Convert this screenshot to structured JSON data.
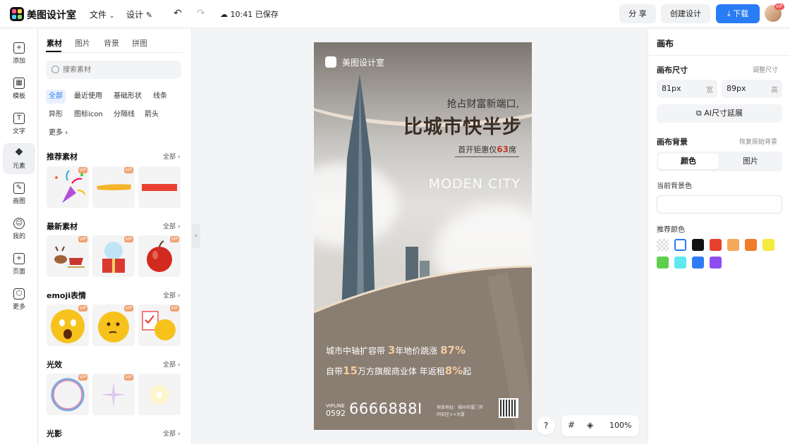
{
  "header": {
    "brand": "美图设计室",
    "menu_file": "文件",
    "menu_design": "设计",
    "saved_status": "10:41 已保存",
    "share_label": "分 享",
    "create_label": "创建设计",
    "download_label": "下载",
    "avatar_badge": "VIP"
  },
  "rail": {
    "items": [
      {
        "label": "添加",
        "icon": "plus-square-icon"
      },
      {
        "label": "模板",
        "icon": "template-grid-icon"
      },
      {
        "label": "文字",
        "icon": "text-T-icon"
      },
      {
        "label": "元素",
        "icon": "shapes-icon"
      },
      {
        "label": "画图",
        "icon": "draw-edit-icon"
      },
      {
        "label": "我的",
        "icon": "user-icon"
      },
      {
        "label": "页面",
        "icon": "add-page-icon"
      },
      {
        "label": "更多",
        "icon": "cube-icon"
      }
    ],
    "active": "元素"
  },
  "panel": {
    "tabs": [
      "素材",
      "图片",
      "背景",
      "拼图"
    ],
    "search_placeholder": "搜索素材",
    "chips": [
      "全部",
      "最近使用",
      "基础形状",
      "线条",
      "异形",
      "图标icon",
      "分隔线",
      "箭头",
      "更多"
    ],
    "all_label": "全部",
    "sections": [
      {
        "title": "推荐素材",
        "items": [
          "confetti-party-popper",
          "yellow-brush-stroke",
          "red-rectangle"
        ]
      },
      {
        "title": "最新素材",
        "items": [
          "reindeer-sleigh",
          "snow-globe-gift",
          "red-apple"
        ]
      },
      {
        "title": "emoji表情",
        "items": [
          "shocked-emoji",
          "thinking-emoji",
          "checklist-chick-emoji"
        ]
      },
      {
        "title": "光效",
        "items": [
          "rainbow-bubble",
          "purple-sparkle",
          "yellow-glow"
        ]
      },
      {
        "title": "光影"
      }
    ],
    "vip_badge": "VIP"
  },
  "poster": {
    "brand": "美图设计室",
    "line1": "抢占财富新端口,",
    "line2": "比城市快半步",
    "line3_pre": "首开钜惠仅",
    "line3_num": "63",
    "line3_post": "席",
    "moden": "MODEN CITY",
    "b1_pre": "城市中轴扩容带",
    "b1_num1": "3",
    "b1_mid": "年地价跳涨",
    "b1_num2": "87%",
    "b2_pre": "自带",
    "b2_num1": "15",
    "b2_mid": "万方旗舰商业体  年返租",
    "b2_num2": "8%",
    "b2_post": "起",
    "vipline": "VIPLINE",
    "area_code": "0592",
    "phone": "6666888I",
    "addr1": "项目地址：福州市厦门市",
    "addr2": "同安区××大厦"
  },
  "zoom": {
    "help": "?",
    "value": "100%"
  },
  "props": {
    "title": "画布",
    "size_label": "画布尺寸",
    "adjust_size": "调整尺寸",
    "width_value": "81px",
    "width_unit": "宽",
    "height_value": "89px",
    "height_unit": "高",
    "ai_extend": "AI尺寸延展",
    "bg_label": "画布背景",
    "restore_bg": "恢复原始背景",
    "seg_color": "颜色",
    "seg_image": "图片",
    "current_bg_label": "当前背景色",
    "recommend_label": "推荐颜色",
    "swatches": [
      "transparent",
      "#ffffff",
      "#111111",
      "#e8402f",
      "#f5a85a",
      "#f07b2c",
      "#f5ea3e",
      "#5fd04d",
      "#5ee8f0",
      "#2f7df5",
      "#8d4cf0"
    ]
  }
}
